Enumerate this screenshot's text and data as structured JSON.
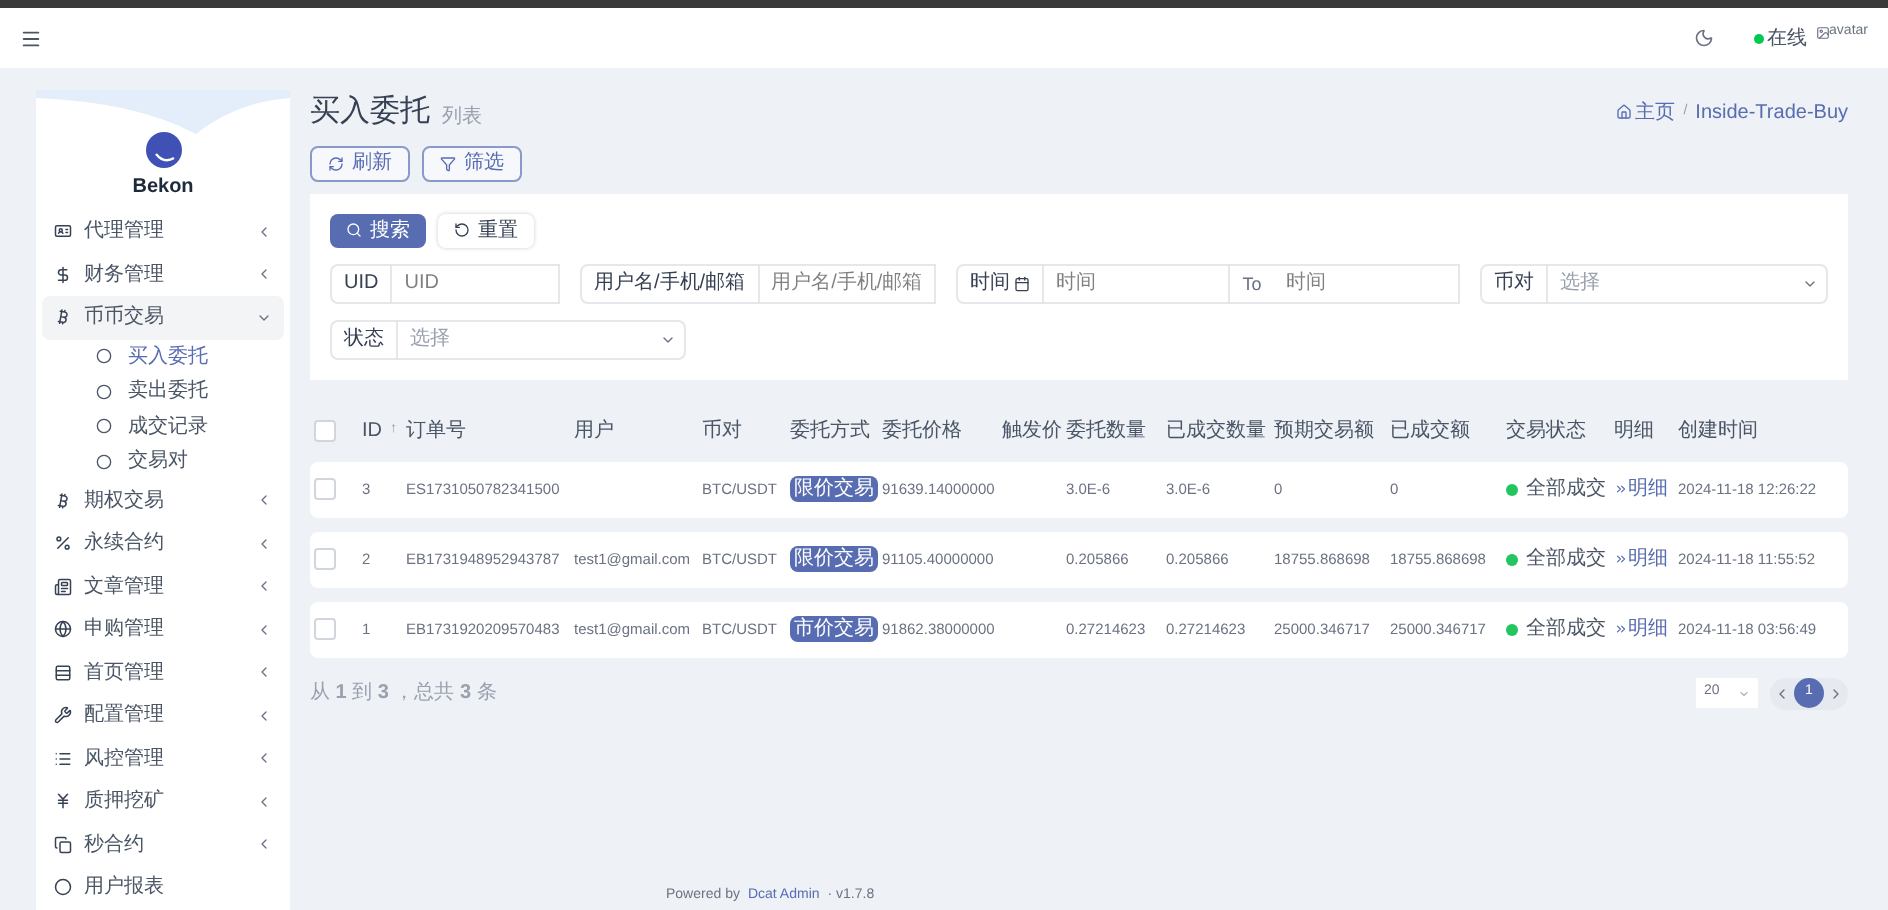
{
  "header": {
    "status": "在线",
    "avatar_alt": "avatar"
  },
  "sidebar": {
    "brand": "Bekon",
    "items": [
      {
        "label": "代理管理",
        "kind": "group",
        "expanded": false
      },
      {
        "label": "财务管理",
        "kind": "group",
        "expanded": false
      },
      {
        "label": "币币交易",
        "kind": "group",
        "expanded": true,
        "children": [
          {
            "label": "买入委托",
            "selected": true
          },
          {
            "label": "卖出委托",
            "selected": false
          },
          {
            "label": "成交记录",
            "selected": false
          },
          {
            "label": "交易对",
            "selected": false
          }
        ]
      },
      {
        "label": "期权交易",
        "kind": "group",
        "expanded": false
      },
      {
        "label": "永续合约",
        "kind": "group",
        "expanded": false
      },
      {
        "label": "文章管理",
        "kind": "group",
        "expanded": false
      },
      {
        "label": "申购管理",
        "kind": "group",
        "expanded": false
      },
      {
        "label": "首页管理",
        "kind": "group",
        "expanded": false
      },
      {
        "label": "配置管理",
        "kind": "group",
        "expanded": false
      },
      {
        "label": "风控管理",
        "kind": "group",
        "expanded": false
      },
      {
        "label": "质押挖矿",
        "kind": "group",
        "expanded": false
      },
      {
        "label": "秒合约",
        "kind": "group",
        "expanded": false
      },
      {
        "label": "用户报表",
        "kind": "link"
      }
    ]
  },
  "page": {
    "title": "买入委托",
    "subtitle": "列表",
    "breadcrumb": [
      "主页",
      "Inside-Trade-Buy"
    ],
    "breadcrumb_separator": "/",
    "buttons": [
      "刷新",
      "筛选"
    ]
  },
  "filter": {
    "buttons": [
      "搜索",
      "重置"
    ],
    "fields": [
      {
        "kind": "text",
        "label": "UID",
        "placeholder": "UID"
      },
      {
        "kind": "text",
        "label": "用户名/手机/邮箱",
        "placeholder": "用户名/手机/邮箱"
      },
      {
        "kind": "range",
        "label": "时间",
        "placeholder": "时间",
        "separator": "To",
        "placeholder_2": "时间"
      },
      {
        "kind": "select",
        "label": "币对",
        "placeholder": "选择"
      },
      {
        "kind": "select",
        "label": "状态",
        "placeholder": "选择"
      }
    ]
  },
  "table": {
    "header_checked": false,
    "sort_indicator": "↑",
    "columns": [
      "ID",
      "订单号",
      "用户",
      "币对",
      "委托方式",
      "委托价格",
      "触发价",
      "委托数量",
      "已成交数量",
      "预期交易额",
      "已成交额",
      "交易状态",
      "明细",
      "创建时间"
    ],
    "rows": [
      {
        "checked": false,
        "id": "3",
        "order_no": "ES1731050782341500",
        "user": "",
        "pair": "BTC/USDT",
        "method": "限价交易",
        "price": "91639.14000000",
        "trigger": "",
        "amount": "3.0E-6",
        "filled": "3.0E-6",
        "expected": "0",
        "filled_value": "0",
        "status": "全部成交",
        "detail": "明细",
        "created": "2024-11-18 12:26:22"
      },
      {
        "checked": false,
        "id": "2",
        "order_no": "EB1731948952943787",
        "user": "test1@gmail.com",
        "pair": "BTC/USDT",
        "method": "限价交易",
        "price": "91105.40000000",
        "trigger": "",
        "amount": "0.205866",
        "filled": "0.205866",
        "expected": "18755.868698",
        "filled_value": "18755.868698",
        "status": "全部成交",
        "detail": "明细",
        "created": "2024-11-18 11:55:52"
      },
      {
        "checked": false,
        "id": "1",
        "order_no": "EB1731920209570483",
        "user": "test1@gmail.com",
        "pair": "BTC/USDT",
        "method": "市价交易",
        "price": "91862.38000000",
        "trigger": "",
        "amount": "0.27214623",
        "filled": "0.27214623",
        "expected": "25000.346717",
        "filled_value": "25000.346717",
        "status": "全部成交",
        "detail": "明细",
        "created": "2024-11-18 03:56:49"
      }
    ]
  },
  "summary": "从 **1** 到 **3** ，总共 **3** 条",
  "pagination": {
    "per_page": "20",
    "pages": [
      {
        "label": "1",
        "selected": true
      }
    ]
  },
  "footer": {
    "prefix": "Powered by",
    "link": "Dcat Admin",
    "suffix": "· v1.7.8"
  }
}
